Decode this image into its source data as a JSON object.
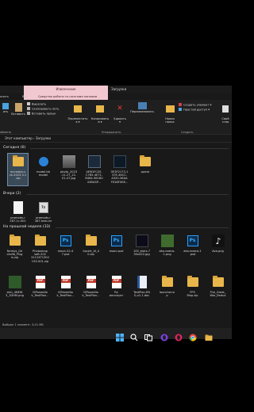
{
  "ribbon_context": {
    "header": "Извлечение",
    "subheader": "Средства работы со сжатыми папками",
    "downloads_tab": "Загрузки"
  },
  "ribbon_tabs": [
    "алить",
    "Вид"
  ],
  "ribbon": {
    "cut": "Вырезать",
    "copy_path": "Скопировать путь",
    "paste_shortcut": "Вставить ярлык",
    "paste": "Вставить",
    "pin_left": "ить",
    "move_to": "Переместить\nв ▾",
    "copy_to": "Копировать\nв ▾",
    "delete": "Удалить\n▾",
    "rename": "Переименовать",
    "new_folder": "Новая\nпапка",
    "new_item": "Создать элемент ▾",
    "easy_access": "Простой доступ ▾",
    "properties": "Свой\nства",
    "group_clipboard": "обмена",
    "group_organize": "Упорядочить",
    "group_new": "Создать"
  },
  "address": "Этот компьютер  ›  Загрузки",
  "sections": {
    "today": "Сегодня (6)",
    "yesterday": "Вчера (2)",
    "last_week": "На прошлой неделе (33)"
  },
  "today_items": [
    {
      "label": "mcreator-v\nck-2023.3.1\n.zip",
      "icon": "zip-folder-icon"
    },
    {
      "label": "model.bb\nmodel",
      "icon": "blockbench-icon"
    },
    {
      "label": "photo_2023\n-11-27_22-\n01-47.jpg",
      "icon": "image-icon"
    },
    {
      "label": "4E9DFC05-\nC7B5-4E71-\nB464-981B0\n085ASP...",
      "icon": "image-icon"
    },
    {
      "label": "0E3F2173-1\n37E-46CC-\nA320-36AA\nFE2BF0E8...",
      "icon": "image-icon"
    },
    {
      "label": ".opera",
      "icon": "folder-icon"
    }
  ],
  "yesterday_items": [
    {
      "label": "promodv-r\n287-1c.001",
      "icon": "document-icon"
    },
    {
      "label": "promodv-r\n287-test.rar",
      "icon": "archive-icon"
    }
  ],
  "last_week_row1": [
    {
      "label": "Nerdys_Ge\nckolib_Plug\nin.zip",
      "icon": "folder-icon"
    },
    {
      "label": "Photoshop\nsoft-202\n31124T1302\n15Z-001.zip",
      "icon": "folder-icon"
    },
    {
      "label": "moon-22-4\n7.psd",
      "icon": "photoshop-icon"
    },
    {
      "label": "1xpert_AI_4\n0.zip",
      "icon": "folder-icon"
    },
    {
      "label": "moon.psd",
      "icon": "photoshop-icon"
    },
    {
      "label": "100_stars-7\n30x422.jpg",
      "icon": "image-icon"
    },
    {
      "label": "aka-ниеса-\n1.png",
      "icon": "image-icon"
    },
    {
      "label": "aka-ниеса-1\n.psd",
      "icon": "photoshop-icon"
    },
    {
      "label": "Ava.png",
      "icon": "image-icon"
    }
  ],
  "last_week_row2": [
    {
      "label": "skin_4NEW\n3_1DHM.png",
      "icon": "image-icon"
    },
    {
      "label": "ISPonedlio\nk_TestPlan...",
      "icon": "pdf-icon"
    },
    {
      "label": "ISPonedlio\nk_TestPlan...",
      "icon": "pdf-icon"
    },
    {
      "label": "ISPonedlio\nk_TestPlan...",
      "icon": "pdf-icon"
    },
    {
      "label": "Rx\nинсинуат",
      "icon": "pdf-icon"
    },
    {
      "label": "TestPlan.EN\nG-v2.1.doc",
      "icon": "document-icon"
    },
    {
      "label": "launcher.si\np",
      "icon": "folder-icon"
    },
    {
      "label": "FPS\nMap.zip",
      "icon": "folder-icon"
    },
    {
      "label": "The_Great_\nWar_Redux",
      "icon": "folder-icon"
    }
  ],
  "status": "Выбран 1 элемент: 3,01 МБ",
  "taskbar": [
    "start-icon",
    "search-icon",
    "task-view-icon",
    "opera-icon",
    "chrome-icon",
    "file-explorer-icon"
  ],
  "colors": {
    "context_tab": "#f2c8d0",
    "folder": "#e8b64b",
    "selection": "#3b4a57",
    "background": "#191919"
  }
}
